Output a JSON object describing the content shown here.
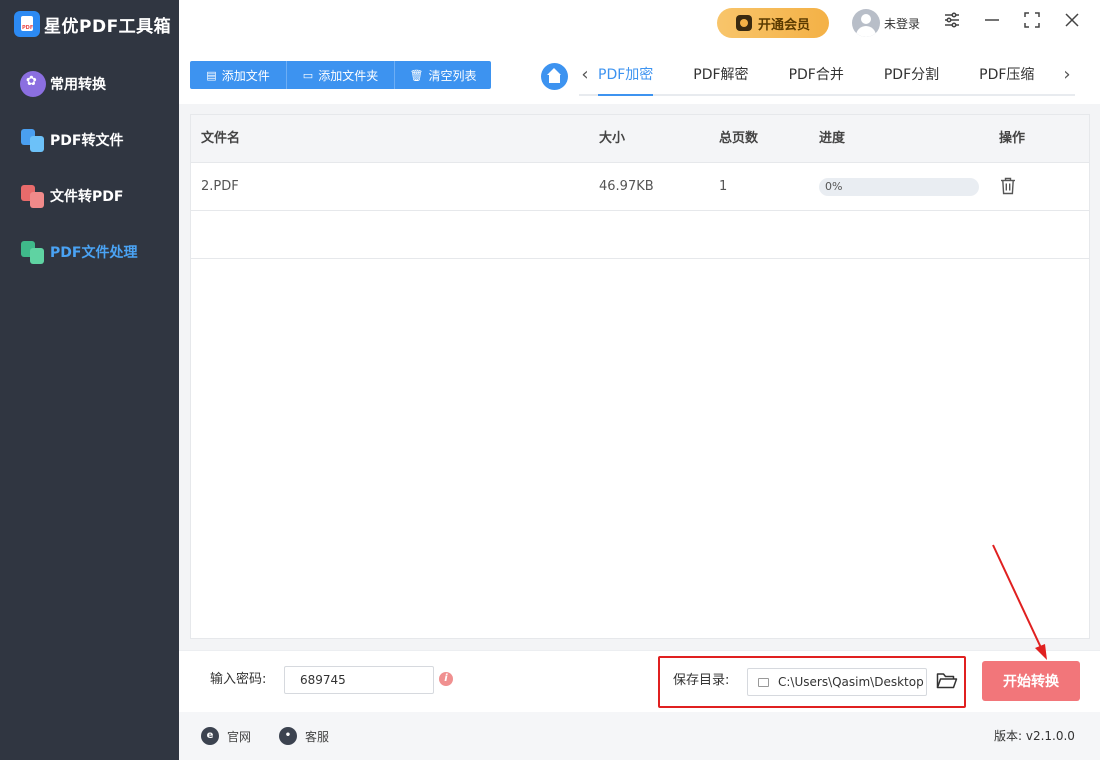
{
  "app": {
    "title": "星优PDF工具箱"
  },
  "sidebar": {
    "items": [
      {
        "label": "常用转换",
        "icon": "common-convert-icon"
      },
      {
        "label": "PDF转文件",
        "icon": "pdf-to-file-icon"
      },
      {
        "label": "文件转PDF",
        "icon": "file-to-pdf-icon"
      },
      {
        "label": "PDF文件处理",
        "icon": "pdf-process-icon",
        "active": true
      }
    ]
  },
  "topbar": {
    "vip_label": "开通会员",
    "user_label": "未登录"
  },
  "toolbar": {
    "add_file": "添加文件",
    "add_folder": "添加文件夹",
    "clear_list": "清空列表"
  },
  "tabs": [
    {
      "label": "PDF加密",
      "active": true
    },
    {
      "label": "PDF解密"
    },
    {
      "label": "PDF合并"
    },
    {
      "label": "PDF分割"
    },
    {
      "label": "PDF压缩"
    }
  ],
  "table": {
    "headers": {
      "name": "文件名",
      "size": "大小",
      "pages": "总页数",
      "progress": "进度",
      "actions": "操作"
    },
    "rows": [
      {
        "name": "2.PDF",
        "size": "46.97KB",
        "pages": "1",
        "progress_text": "0%",
        "progress": 0
      }
    ]
  },
  "bottom": {
    "password_label": "输入密码:",
    "password_value": "689745",
    "dir_label": "保存目录:",
    "dir_value": "C:\\Users\\Qasim\\Desktop",
    "start_button": "开始转换"
  },
  "footer": {
    "website": "官网",
    "support": "客服",
    "version": "版本: v2.1.0.0"
  },
  "colors": {
    "sidebar_bg": "#303641",
    "accent": "#3d93f0",
    "start_button": "#f2767a",
    "highlight": "#e02020"
  }
}
